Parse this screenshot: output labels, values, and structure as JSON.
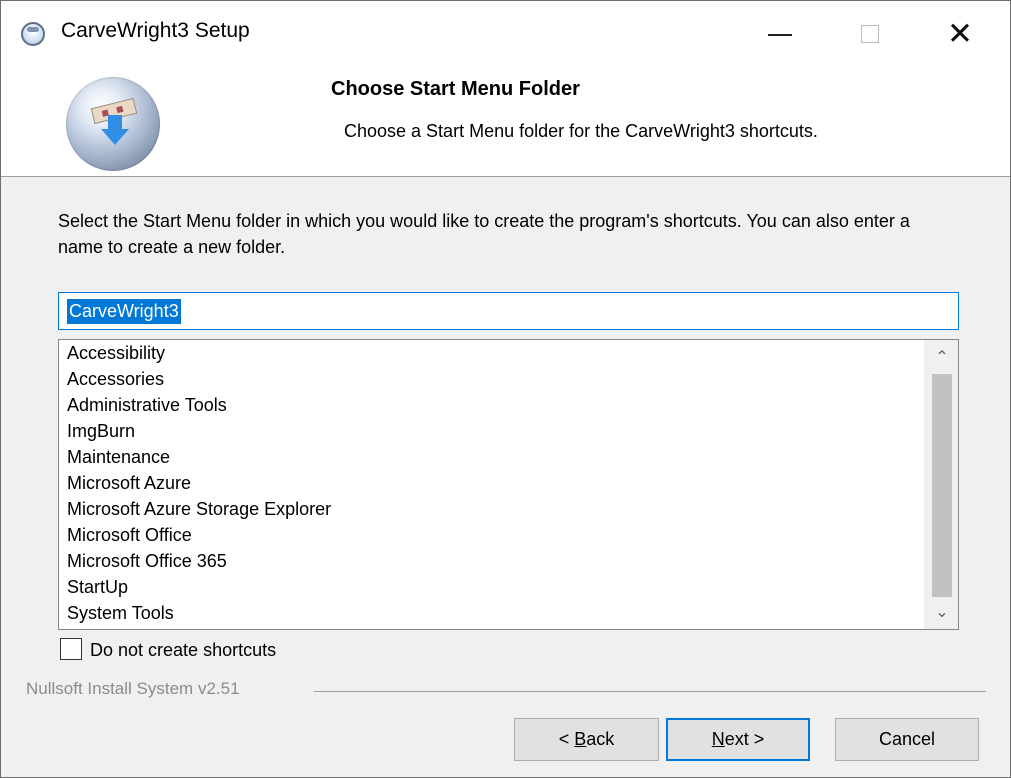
{
  "window": {
    "title": "CarveWright3 Setup",
    "app_icon": "installer-icon",
    "controls": {
      "minimize_icon": "minimize-icon",
      "maximize_icon": "maximize-icon",
      "close_icon": "close-icon",
      "close_glyph": "✕"
    }
  },
  "header": {
    "title": "Choose Start Menu Folder",
    "subtitle": "Choose a Start Menu folder for the CarveWright3 shortcuts.",
    "logo_icon": "setup-logo-icon"
  },
  "main": {
    "instructions": "Select the Start Menu folder in which you would like to create the program's shortcuts. You can also enter a name to create a new folder.",
    "folder_input": {
      "value": "CarveWright3",
      "selected": true
    },
    "folders": [
      "Accessibility",
      "Accessories",
      "Administrative Tools",
      "ImgBurn",
      "Maintenance",
      "Microsoft Azure",
      "Microsoft Azure Storage Explorer",
      "Microsoft Office",
      "Microsoft Office 365",
      "StartUp",
      "System Tools"
    ],
    "scrollbar": {
      "up_glyph": "⌃",
      "down_glyph": "⌄"
    },
    "no_shortcuts": {
      "label": "Do not create shortcuts",
      "checked": false
    }
  },
  "footer": {
    "branding": "Nullsoft Install System v2.51",
    "buttons": {
      "back": {
        "prefix": "< ",
        "mnemonic": "B",
        "rest": "ack"
      },
      "next": {
        "mnemonic": "N",
        "rest": "ext >"
      },
      "cancel": "Cancel"
    }
  },
  "colors": {
    "accent": "#0078d7",
    "dialog_bg": "#f0f0f0",
    "header_bg": "#ffffff"
  }
}
